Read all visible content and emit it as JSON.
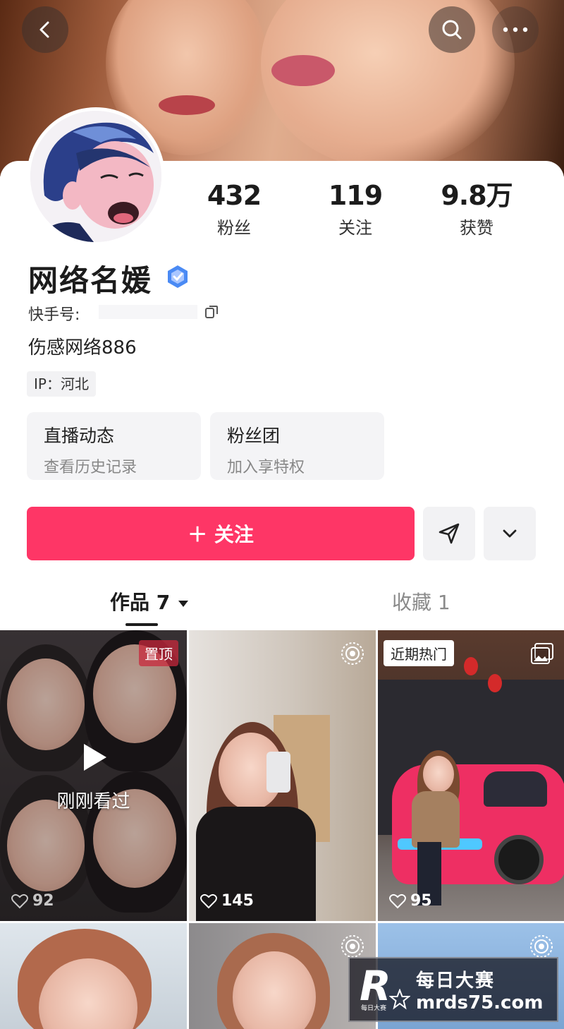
{
  "colors": {
    "accent": "#fe3666",
    "verify": "#4a8af4"
  },
  "top_bar": {
    "back_icon": "chevron-left-icon",
    "search_icon": "search-icon",
    "more_icon": "more-horizontal-icon"
  },
  "profile": {
    "stats": [
      {
        "value": "432",
        "label": "粉丝"
      },
      {
        "value": "119",
        "label": "关注"
      },
      {
        "value": "9.8万",
        "label": "获赞"
      }
    ],
    "name": "网络名媛",
    "kuaishou_id_label": "快手号:",
    "bio": "伤感网络886",
    "ip": "IP：河北"
  },
  "cards": [
    {
      "title": "直播动态",
      "subtitle": "查看历史记录"
    },
    {
      "title": "粉丝团",
      "subtitle": "加入享特权"
    }
  ],
  "actions": {
    "follow_label": "＋ 关注"
  },
  "tabs": [
    {
      "label": "作品 7",
      "active": true
    },
    {
      "label": "收藏 1",
      "active": false
    }
  ],
  "grid": [
    {
      "likes": "92",
      "badge": "置顶",
      "overlay": "刚刚看过"
    },
    {
      "likes": "145"
    },
    {
      "likes": "95",
      "badge": "近期热门"
    }
  ],
  "watermark": {
    "logo": "R",
    "logo_sub": "每日大赛",
    "title": "每日大赛",
    "url": "mrds75.com"
  }
}
